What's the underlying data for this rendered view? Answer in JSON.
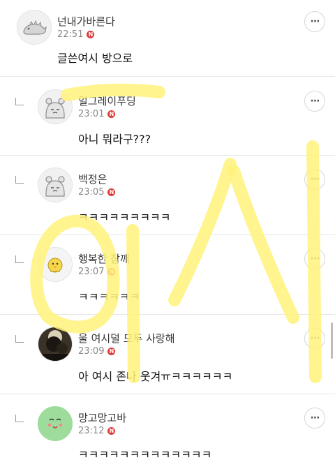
{
  "comments": [
    {
      "nick": "넌내가바른다",
      "time": "22:51",
      "badge": "N",
      "text": "글쓴여시 방으로",
      "more_label": "···",
      "avatar": "dinosaur-avatar"
    },
    {
      "nick": "얼그레이푸딩",
      "time": "23:01",
      "badge": "N",
      "text": "아니 뭐라구???",
      "more_label": "···",
      "avatar": "animal-avatar"
    },
    {
      "nick": "백정은",
      "time": "23:05",
      "badge": "N",
      "text": "ㅋㅋㅋㅋㅋㅋㅋㅋㅋ",
      "more_label": "···",
      "avatar": "animal-avatar"
    },
    {
      "nick": "행복한 참깨",
      "time": "23:07",
      "badge": "N",
      "text": "ㅋㅋㅋㅋㅋㅋ",
      "more_label": "···",
      "avatar": "chick-avatar"
    },
    {
      "nick": "울 여시덜 모두 사랑해",
      "time": "23:09",
      "badge": "N",
      "text": "아 여시 존나 웃겨ㅠㅋㅋㅋㅋㅋㅋ",
      "more_label": "···",
      "avatar": "photo-avatar"
    },
    {
      "nick": "망고망고바",
      "time": "23:12",
      "badge": "N",
      "text": "ㅋㅋㅋㅋㅋㅋㅋㅋㅋㅋㅋㅋㅋ",
      "more_label": "···",
      "avatar": "smiley-avatar"
    }
  ],
  "colors": {
    "highlighter": "#fff27a",
    "badge": "#e03a3a",
    "avatar_green": "#9ddc9a"
  }
}
